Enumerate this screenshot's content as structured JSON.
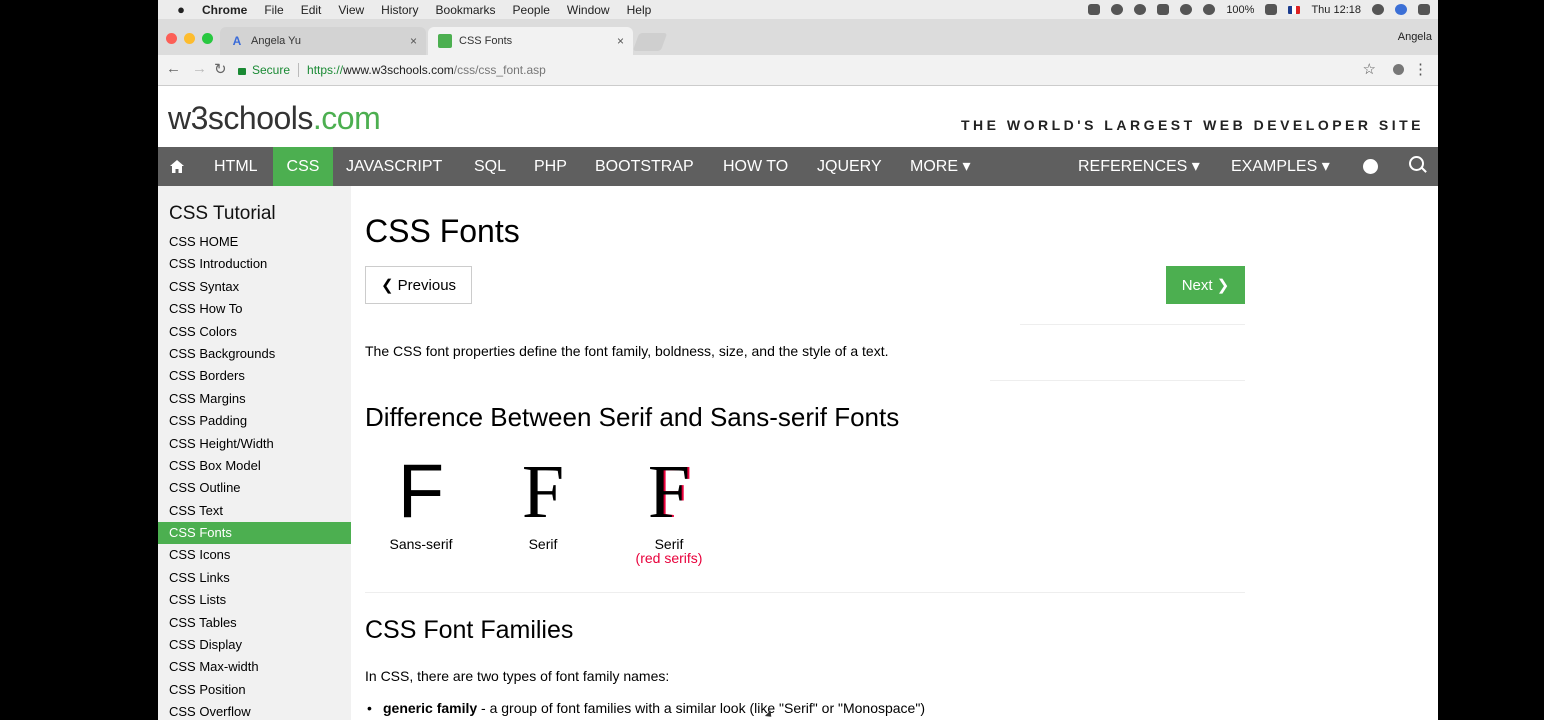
{
  "menubar": {
    "app": "Chrome",
    "items": [
      "File",
      "Edit",
      "View",
      "History",
      "Bookmarks",
      "People",
      "Window",
      "Help"
    ],
    "battery": "100%",
    "clock": "Thu 12:18"
  },
  "tabs": [
    {
      "label": "Angela Yu",
      "close": "×"
    },
    {
      "label": "CSS Fonts",
      "close": "×"
    }
  ],
  "profile_name": "Angela",
  "address": {
    "secure": "Secure",
    "url_proto": "https://",
    "url_host": "www.w3schools.com",
    "url_path": "/css/css_font.asp"
  },
  "site": {
    "logo_main": "w3schools",
    "logo_tld": ".com",
    "tagline": "THE WORLD'S LARGEST WEB DEVELOPER SITE"
  },
  "topnav": {
    "items": [
      "HTML",
      "CSS",
      "JAVASCRIPT",
      "SQL",
      "PHP",
      "BOOTSTRAP",
      "HOW TO",
      "JQUERY",
      "MORE ▾"
    ],
    "right": [
      "REFERENCES ▾",
      "EXAMPLES ▾"
    ],
    "active": "CSS"
  },
  "sidebar": {
    "title": "CSS Tutorial",
    "items": [
      "CSS HOME",
      "CSS Introduction",
      "CSS Syntax",
      "CSS How To",
      "CSS Colors",
      "CSS Backgrounds",
      "CSS Borders",
      "CSS Margins",
      "CSS Padding",
      "CSS Height/Width",
      "CSS Box Model",
      "CSS Outline",
      "CSS Text",
      "CSS Fonts",
      "CSS Icons",
      "CSS Links",
      "CSS Lists",
      "CSS Tables",
      "CSS Display",
      "CSS Max-width",
      "CSS Position",
      "CSS Overflow"
    ],
    "active_index": 13
  },
  "main": {
    "title": "CSS Fonts",
    "prev": "❮ Previous",
    "next": "Next ❯",
    "intro": "The CSS font properties define the font family, boldness, size, and the style of a text.",
    "section1": "Difference Between Serif and Sans-serif Fonts",
    "demos": [
      {
        "glyph": "F",
        "caption": "Sans-serif",
        "note": ""
      },
      {
        "glyph": "F",
        "caption": "Serif",
        "note": ""
      },
      {
        "glyph": "F",
        "caption": "Serif",
        "note": "(red serifs)"
      }
    ],
    "section2": "CSS Font Families",
    "families_intro": "In CSS, there are two types of font family names:",
    "bullet_term": "generic family",
    "bullet_text": " - a group of font families with a similar look (like \"Serif\" or \"Monospace\")"
  },
  "colors": {
    "w3_green": "#4caf50",
    "nav_bg": "#5f5f5f",
    "sidebar_bg": "#f1f1f1",
    "serif_red": "#e8003b"
  }
}
